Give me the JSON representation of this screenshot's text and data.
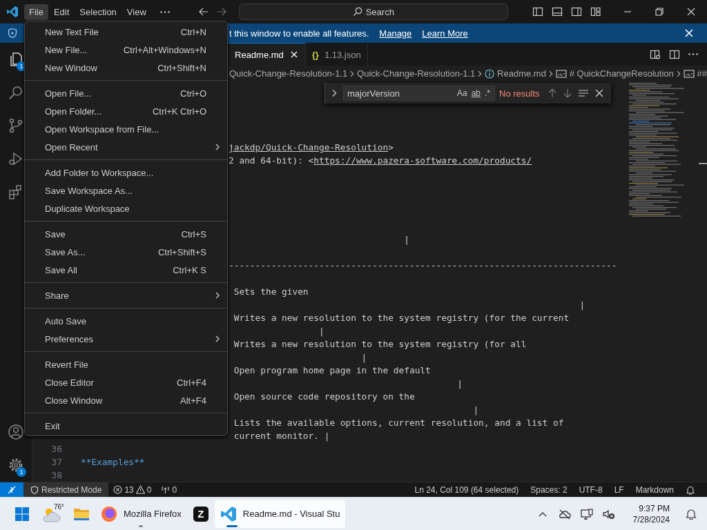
{
  "title_bar": {
    "menus": [
      {
        "label": "File",
        "selected": true
      },
      {
        "label": "Edit",
        "selected": false
      },
      {
        "label": "Selection",
        "selected": false
      },
      {
        "label": "View",
        "selected": false
      }
    ],
    "search": {
      "placeholder": "Search"
    }
  },
  "banner": {
    "message": "t this window to enable all features.",
    "links": [
      "Manage",
      "Learn More"
    ]
  },
  "activity_bar": {
    "top": [
      {
        "kind": "explorer",
        "badge": "1"
      },
      {
        "kind": "search"
      },
      {
        "kind": "source-control"
      },
      {
        "kind": "run-debug"
      },
      {
        "kind": "extensions"
      }
    ],
    "bottom": [
      {
        "kind": "accounts"
      },
      {
        "kind": "manage",
        "badge": "1"
      }
    ]
  },
  "tabs": [
    {
      "label": "Readme.md",
      "selected": true,
      "kind": "markdown"
    },
    {
      "label": "1.13.json",
      "selected": false,
      "kind": "json",
      "icon": "{}"
    }
  ],
  "breadcrumb": [
    {
      "label": "Quick-Change-Resolution-1.1",
      "kind": "folder"
    },
    {
      "label": "Quick-Change-Resolution-1.1",
      "kind": "folder"
    },
    {
      "label": "Readme.md",
      "kind": "file"
    },
    {
      "label": "# QuickChangeResolution",
      "kind": "symbol"
    },
    {
      "label": "##",
      "kind": "symbol"
    }
  ],
  "find_widget": {
    "value": "majorVersion",
    "options": [
      "Aa",
      "ab",
      ".*"
    ],
    "result": "No results"
  },
  "editor": {
    "lines": [
      {
        "kind": "blank"
      },
      {
        "kind": "blank"
      },
      {
        "kind": "blank"
      },
      {
        "kind": "blank"
      },
      {
        "kind": "covered",
        "parts": [
          {
            "text": "jackdp/Quick-Change-Resolution",
            "link": true
          },
          {
            "text": ">",
            "link": false
          }
        ]
      },
      {
        "kind": "covered",
        "parts": [
          {
            "text": "2 and 64-bit): <",
            "link": false
          },
          {
            "text": "https://www.pazera-software.com/products/",
            "link": true
          }
        ]
      },
      {
        "kind": "blank"
      },
      {
        "kind": "blank"
      },
      {
        "kind": "blank"
      },
      {
        "kind": "blank"
      },
      {
        "kind": "blank"
      },
      {
        "kind": "covered",
        "parts": [
          {
            "text": "                                 |",
            "link": false
          }
        ]
      },
      {
        "kind": "blank"
      },
      {
        "kind": "covered",
        "parts": [
          {
            "text": "-------------------------------------------------------------------------",
            "link": false
          }
        ]
      },
      {
        "kind": "blank"
      },
      {
        "kind": "covered",
        "parts": [
          {
            "text": " Sets the given",
            "link": false
          }
        ]
      },
      {
        "kind": "covered",
        "parts": [
          {
            "text": "                                                                  |",
            "link": false
          }
        ]
      },
      {
        "kind": "covered",
        "parts": [
          {
            "text": " Writes a new resolution to the system registry (for the current",
            "link": false
          }
        ]
      },
      {
        "kind": "covered",
        "parts": [
          {
            "text": "                 |",
            "link": false
          }
        ]
      },
      {
        "kind": "covered",
        "parts": [
          {
            "text": " Writes a new resolution to the system registry (for all",
            "link": false
          }
        ]
      },
      {
        "kind": "covered",
        "parts": [
          {
            "text": "                         |",
            "link": false
          }
        ]
      },
      {
        "kind": "covered",
        "parts": [
          {
            "text": " Open program home page in the default",
            "link": false
          }
        ]
      },
      {
        "kind": "covered",
        "parts": [
          {
            "text": "                                           |",
            "link": false
          }
        ]
      },
      {
        "kind": "covered",
        "parts": [
          {
            "text": " Open source code repository on the",
            "link": false
          }
        ]
      },
      {
        "kind": "covered",
        "parts": [
          {
            "text": "                                              |",
            "link": false
          }
        ]
      },
      {
        "kind": "covered",
        "parts": [
          {
            "text": " Lists the available options, current resolution, and a list of",
            "link": false
          }
        ]
      },
      {
        "kind": "covered",
        "parts": [
          {
            "text": " current monitor. |",
            "link": false
          }
        ]
      },
      {
        "kind": "full",
        "number": "36"
      },
      {
        "kind": "full",
        "number": "37",
        "text": "**Examples**",
        "color": "#569cd6"
      },
      {
        "kind": "full",
        "number": "38"
      }
    ]
  },
  "file_menu": {
    "groups": [
      [
        {
          "label": "New Text File",
          "shortcut": "Ctrl+N",
          "submenu": false
        },
        {
          "label": "New File...",
          "shortcut": "Ctrl+Alt+Windows+N",
          "submenu": false
        },
        {
          "label": "New Window",
          "shortcut": "Ctrl+Shift+N",
          "submenu": false
        }
      ],
      [
        {
          "label": "Open File...",
          "shortcut": "Ctrl+O",
          "submenu": false
        },
        {
          "label": "Open Folder...",
          "shortcut": "Ctrl+K Ctrl+O",
          "submenu": false
        },
        {
          "label": "Open Workspace from File...",
          "submenu": false
        },
        {
          "label": "Open Recent",
          "submenu": true
        }
      ],
      [
        {
          "label": "Add Folder to Workspace...",
          "submenu": false
        },
        {
          "label": "Save Workspace As...",
          "submenu": false
        },
        {
          "label": "Duplicate Workspace",
          "submenu": false
        }
      ],
      [
        {
          "label": "Save",
          "shortcut": "Ctrl+S",
          "submenu": false
        },
        {
          "label": "Save As...",
          "shortcut": "Ctrl+Shift+S",
          "submenu": false
        },
        {
          "label": "Save All",
          "shortcut": "Ctrl+K S",
          "submenu": false
        }
      ],
      [
        {
          "label": "Share",
          "submenu": true
        }
      ],
      [
        {
          "label": "Auto Save",
          "submenu": false
        },
        {
          "label": "Preferences",
          "submenu": true
        }
      ],
      [
        {
          "label": "Revert File",
          "submenu": false
        },
        {
          "label": "Close Editor",
          "shortcut": "Ctrl+F4",
          "submenu": false
        },
        {
          "label": "Close Window",
          "shortcut": "Alt+F4",
          "submenu": false
        }
      ],
      [
        {
          "label": "Exit",
          "submenu": false
        }
      ]
    ]
  },
  "status_bar": {
    "restricted_mode": "Restricted Mode",
    "errors": "13",
    "warnings": "0",
    "ports": "0",
    "items": [
      "Ln 24, Col 109 (64 selected)",
      "Spaces: 2",
      "UTF-8",
      "LF",
      "Markdown"
    ]
  },
  "taskbar": {
    "weather": "76°",
    "apps": [
      {
        "kind": "folder",
        "selected": false,
        "running": false
      },
      {
        "kind": "firefox",
        "label": "Mozilla Firefox",
        "selected": false,
        "running": true
      },
      {
        "kind": "z",
        "icon_text": "Z",
        "selected": false,
        "running": false
      },
      {
        "kind": "vscode",
        "label": "Readme.md - Visual Stu",
        "selected": true,
        "running": true
      }
    ],
    "time": "9:37 PM",
    "date": "7/28/2024"
  }
}
